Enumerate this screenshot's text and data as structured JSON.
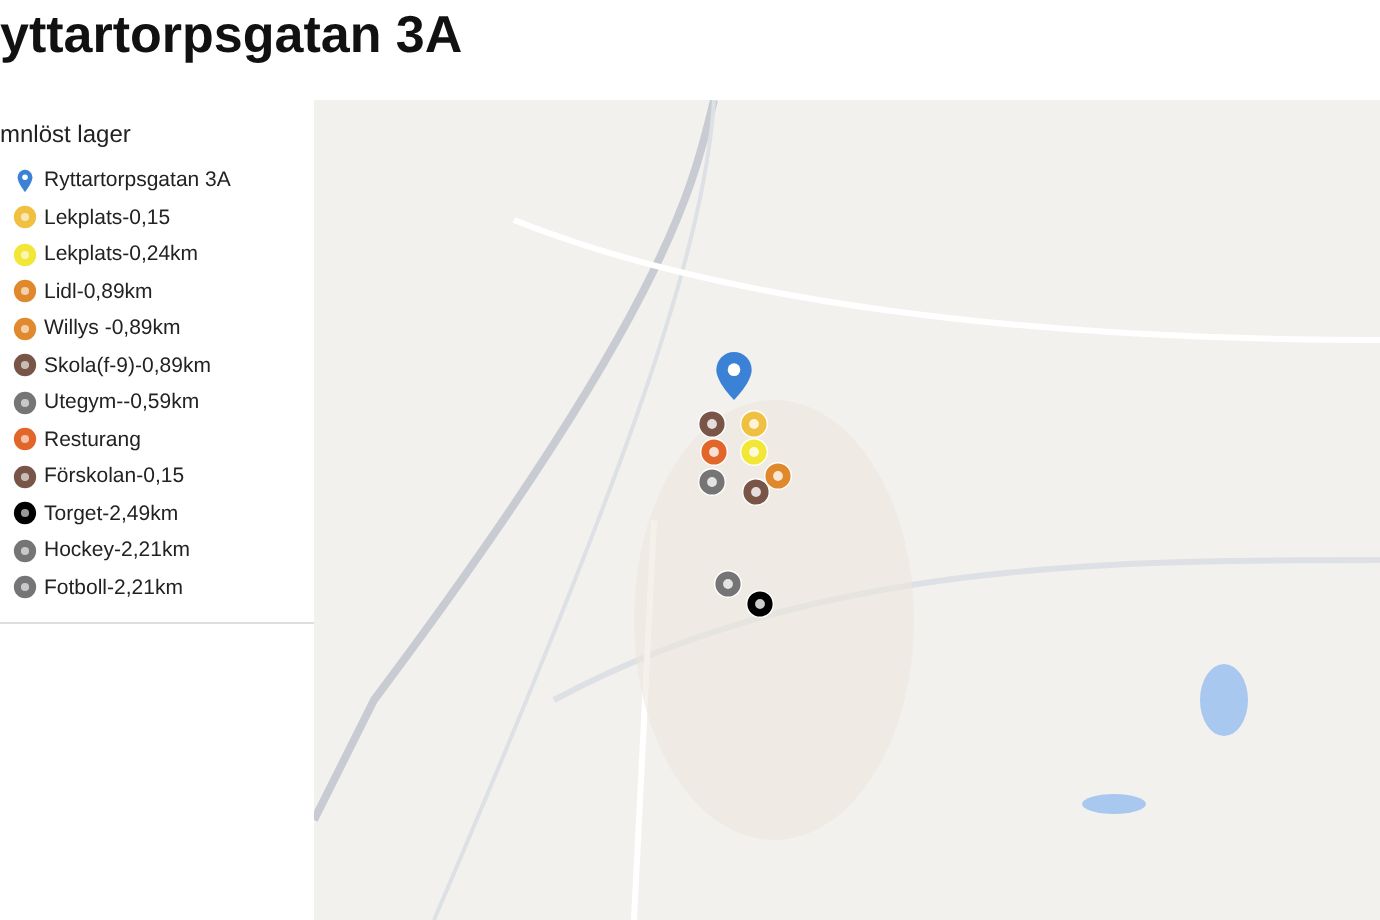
{
  "title": "yttartorpsgatan 3A",
  "layer": {
    "name": "mnlöst lager",
    "items": [
      {
        "kind": "pin",
        "label": "Ryttartorpsgatan 3A",
        "color": "#3b82d6"
      },
      {
        "kind": "circle",
        "label": "Lekplats-0,15",
        "color": "#f0c040"
      },
      {
        "kind": "circle",
        "label": "Lekplats-0,24km",
        "color": "#f2e637"
      },
      {
        "kind": "circle",
        "label": "Lidl-0,89km",
        "color": "#e0892c"
      },
      {
        "kind": "circle",
        "label": "Willys -0,89km",
        "color": "#e0892d"
      },
      {
        "kind": "circle",
        "label": "Skola(f-9)-0,89km",
        "color": "#795548"
      },
      {
        "kind": "circle",
        "label": "Utegym--0,59km",
        "color": "#757575"
      },
      {
        "kind": "circle",
        "label": "Resturang",
        "color": "#e2662a"
      },
      {
        "kind": "circle",
        "label": "Förskolan-0,15",
        "color": "#795549"
      },
      {
        "kind": "circle",
        "label": "Torget-2,49km",
        "color": "#000000"
      },
      {
        "kind": "circle",
        "label": "Hockey-2,21km",
        "color": "#757576"
      },
      {
        "kind": "circle",
        "label": "Fotboll-2,21km",
        "color": "#757577"
      }
    ]
  }
}
